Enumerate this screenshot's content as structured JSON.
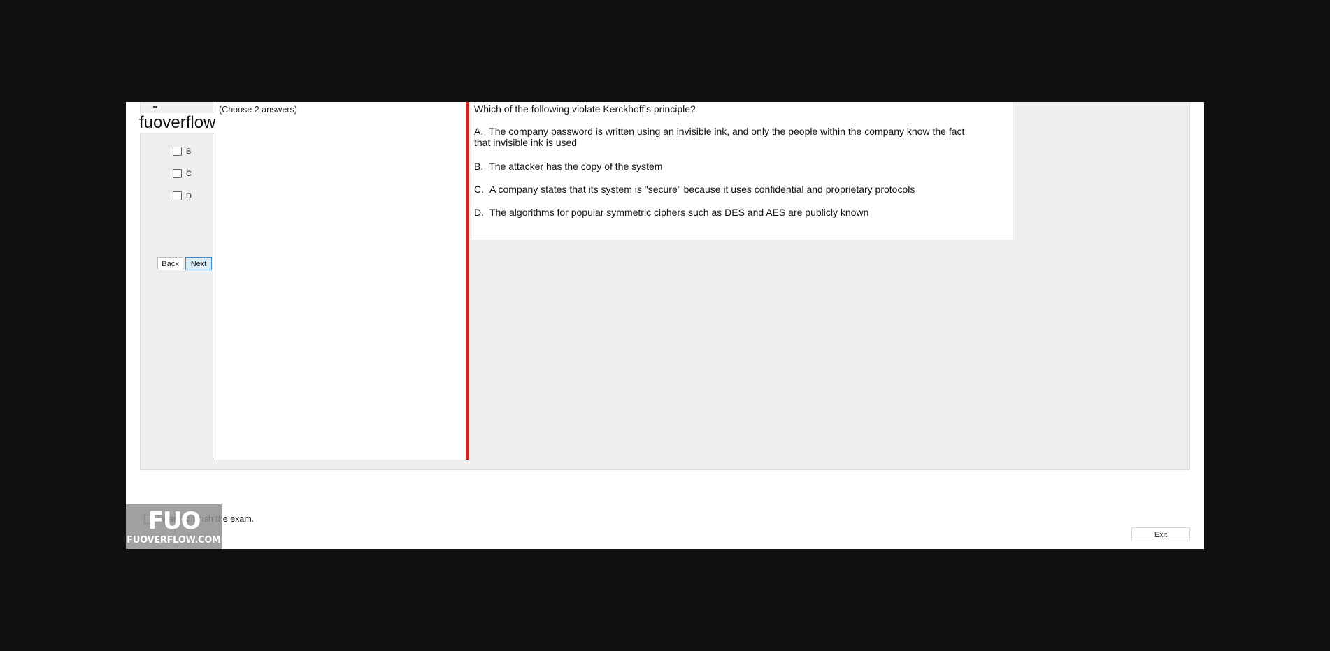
{
  "watermark": {
    "text": "fuoverflow"
  },
  "instructions": {
    "text": "(Choose 2 answers)"
  },
  "question": {
    "stem": "Which of the following violate Kerckhoff's principle?",
    "options": [
      {
        "letter": "A.",
        "text": "The company password is written using an invisible ink, and only the people within the company know the fact that invisible ink is used"
      },
      {
        "letter": "B.",
        "text": "The attacker has the copy of the system"
      },
      {
        "letter": "C.",
        "text": "A company states that its system is \"secure\" because it uses confidential and proprietary protocols"
      },
      {
        "letter": "D.",
        "text": "The algorithms for popular symmetric ciphers such as DES and AES are publicly known"
      }
    ]
  },
  "answers": [
    {
      "label": "B",
      "checked": false
    },
    {
      "label": "C",
      "checked": false
    },
    {
      "label": "D",
      "checked": false
    }
  ],
  "nav": {
    "back_label": "Back",
    "next_label": "Next"
  },
  "finish": {
    "label": "I want to finish the exam.",
    "checked": false
  },
  "exit": {
    "label": "Exit"
  },
  "logo": {
    "main": "FUO",
    "sub": "FUOVERFLOW.COM"
  },
  "colors": {
    "splitter": "#d0211c",
    "next_button_bg": "#d8ecf9",
    "next_button_border": "#3a8bd0",
    "background": "#101010"
  }
}
